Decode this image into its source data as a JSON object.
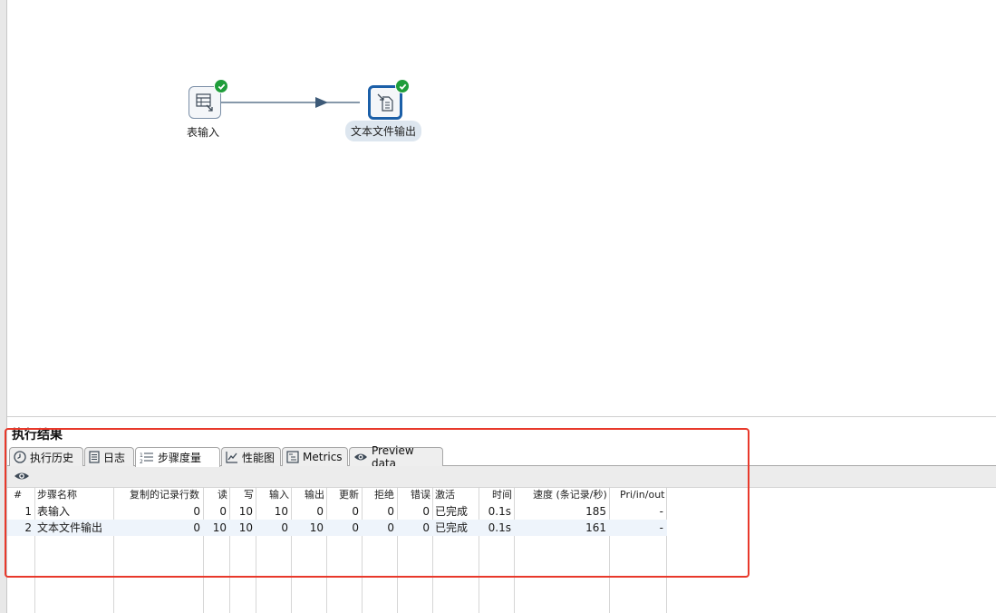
{
  "canvas": {
    "steps": [
      {
        "label": "表输入",
        "status": "completed"
      },
      {
        "label": "文本文件输出",
        "status": "completed"
      }
    ]
  },
  "results": {
    "title": "执行结果",
    "tabs": [
      {
        "label": "执行历史",
        "icon": "history-clock-icon"
      },
      {
        "label": "日志",
        "icon": "log-document-icon"
      },
      {
        "label": "步骤度量",
        "icon": "step-metrics-list-icon",
        "active": true
      },
      {
        "label": "性能图",
        "icon": "performance-chart-icon"
      },
      {
        "label": "Metrics",
        "icon": "metrics-tree-icon"
      },
      {
        "label": "Preview data",
        "icon": "preview-eye-icon"
      }
    ],
    "toolbar": {
      "icon": "eye-icon"
    },
    "columns": [
      "#",
      "步骤名称",
      "复制的记录行数",
      "读",
      "写",
      "输入",
      "输出",
      "更新",
      "拒绝",
      "错误",
      "激活",
      "时间",
      "速度 (条记录/秒)",
      "Pri/in/out"
    ],
    "rows": [
      [
        "1",
        "表输入",
        "0",
        "0",
        "10",
        "10",
        "0",
        "0",
        "0",
        "0",
        "已完成",
        "0.1s",
        "185",
        "-"
      ],
      [
        "2",
        "文本文件输出",
        "0",
        "10",
        "10",
        "0",
        "10",
        "0",
        "0",
        "0",
        "已完成",
        "0.1s",
        "161",
        "-"
      ]
    ]
  },
  "colors": {
    "highlight": "#e8392b",
    "success": "#1f9d3a",
    "selected_border": "#1b5fa8",
    "row_alt": "#eef4fb"
  }
}
